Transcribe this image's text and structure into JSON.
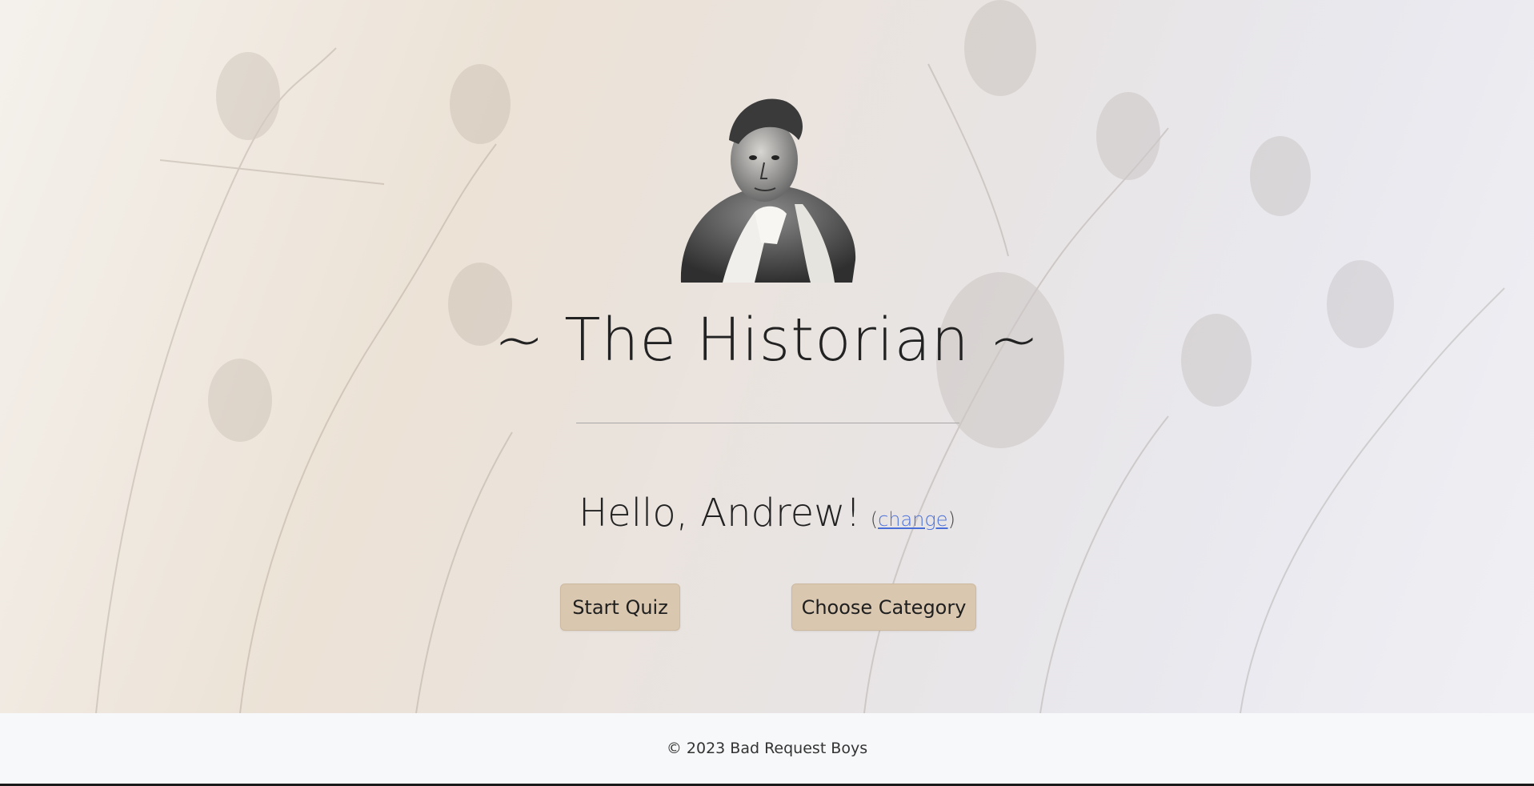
{
  "header": {
    "title": "~ The Historian ~"
  },
  "greeting": {
    "text": "Hello, Andrew!",
    "change_open": "(",
    "change_label": "change",
    "change_close": ")"
  },
  "actions": {
    "start_quiz_label": "Start Quiz",
    "choose_category_label": "Choose Category"
  },
  "footer": {
    "copyright": "© 2023 Bad Request Boys"
  },
  "theme": {
    "button_bg": "#d9c7b0",
    "link_color": "#4a6fd8",
    "footer_bg": "#f7f8f9"
  }
}
